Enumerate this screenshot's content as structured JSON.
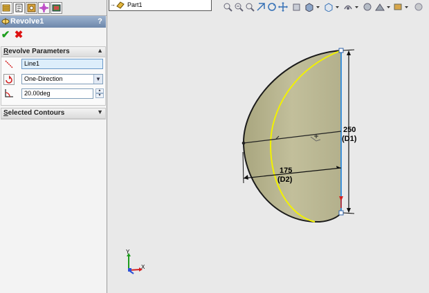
{
  "property_manager": {
    "title": "Revolve1",
    "help": "?",
    "ok": "✔",
    "cancel": "✖",
    "revolve_parameters": {
      "header_prefix": "R",
      "header_rest": "evolve Parameters",
      "axis": "Line1",
      "direction": "One-Direction",
      "angle": "20.00deg"
    },
    "selected_contours": {
      "header_prefix": "S",
      "header_rest": "elected Contours"
    }
  },
  "feature_tree": {
    "part": "Part1"
  },
  "sketch": {
    "dim_vertical_value": "250",
    "dim_vertical_name": "(D1)",
    "dim_horizontal_value": "175",
    "dim_horizontal_name": "(D2)"
  },
  "triad": {
    "y_label": "Y",
    "x_label": "X"
  },
  "colors": {
    "solid_fill": "#b8b48e",
    "edge_highlight": "#f2f200",
    "axis_line": "#3c8fd8",
    "title_bar": "#7f98bb"
  }
}
